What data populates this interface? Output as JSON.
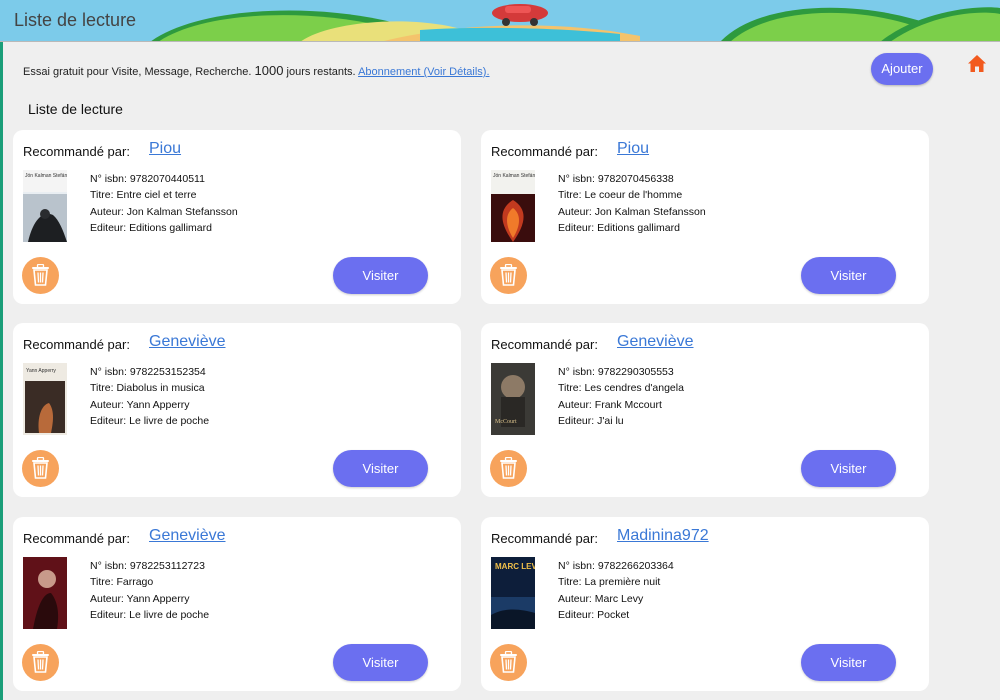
{
  "header": {
    "title": "Liste de lecture"
  },
  "trial": {
    "text": "Essai gratuit pour Visite, Message, Recherche.",
    "days": "1000",
    "days_suffix": "jours restants.",
    "link": "Abonnement (Voir Détails)."
  },
  "actions": {
    "add_label": "Ajouter",
    "home_icon": "home-icon"
  },
  "section_title": "Liste de lecture",
  "labels": {
    "recommended_by": "Recommandé par:",
    "visit": "Visiter",
    "isbn": "N° isbn:",
    "title": "Titre:",
    "author": "Auteur:",
    "publisher": "Editeur:"
  },
  "books": [
    {
      "recommender": "Piou",
      "isbn": "9782070440511",
      "title": "Entre ciel et terre",
      "author": "Jon Kalman Stefansson",
      "publisher": "Editions gallimard",
      "cover_text": "Jón Kalman Stefánsson"
    },
    {
      "recommender": "Piou",
      "isbn": "9782070456338",
      "title": "Le coeur de l'homme",
      "author": "Jon Kalman Stefansson",
      "publisher": "Editions gallimard",
      "cover_text": "Jón Kalman Stefánsson"
    },
    {
      "recommender": "Geneviève",
      "isbn": "9782253152354",
      "title": "Diabolus in musica",
      "author": "Yann Apperry",
      "publisher": "Le livre de poche",
      "cover_text": "Yann Apperry"
    },
    {
      "recommender": "Geneviève",
      "isbn": "9782290305553",
      "title": "Les cendres d'angela",
      "author": "Frank Mccourt",
      "publisher": "J'ai lu",
      "cover_text": "McCourt"
    },
    {
      "recommender": "Geneviève",
      "isbn": "9782253112723",
      "title": "Farrago",
      "author": "Yann Apperry",
      "publisher": "Le livre de poche",
      "cover_text": ""
    },
    {
      "recommender": "Madinina972",
      "isbn": "9782266203364",
      "title": "La première nuit",
      "author": "Marc Levy",
      "publisher": "Pocket",
      "cover_text": "MARC LEVY"
    }
  ],
  "colors": {
    "accent": "#6b6ff0",
    "trash": "#f7a35c",
    "link": "#3a78d6",
    "home": "#f25a1e"
  }
}
